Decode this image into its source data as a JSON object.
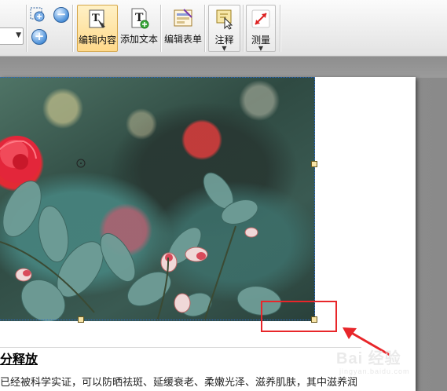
{
  "toolbar": {
    "buttons": [
      {
        "label": "编辑内容",
        "active": true
      },
      {
        "label": "添加文本"
      },
      {
        "label": "编辑表单"
      },
      {
        "label": "注释",
        "has_dropdown": true
      },
      {
        "label": "测量",
        "has_dropdown": true
      }
    ],
    "zoom_in": "+",
    "zoom_out": "−",
    "zoom_combo": ""
  },
  "document": {
    "heading": "分释放",
    "body": "已经被科学实证，可以防晒祛斑、延缓衰老、柔嫩光泽、滋养肌肤，其中滋养润",
    "image_alt": "red camellia flowers photo"
  },
  "watermark": {
    "text": "Bai 经验",
    "sub": "jingyan.baidu.com"
  },
  "colors": {
    "accent_active": "#ffd98a",
    "selection": "#2a6bd1",
    "highlight": "#e8262a"
  }
}
